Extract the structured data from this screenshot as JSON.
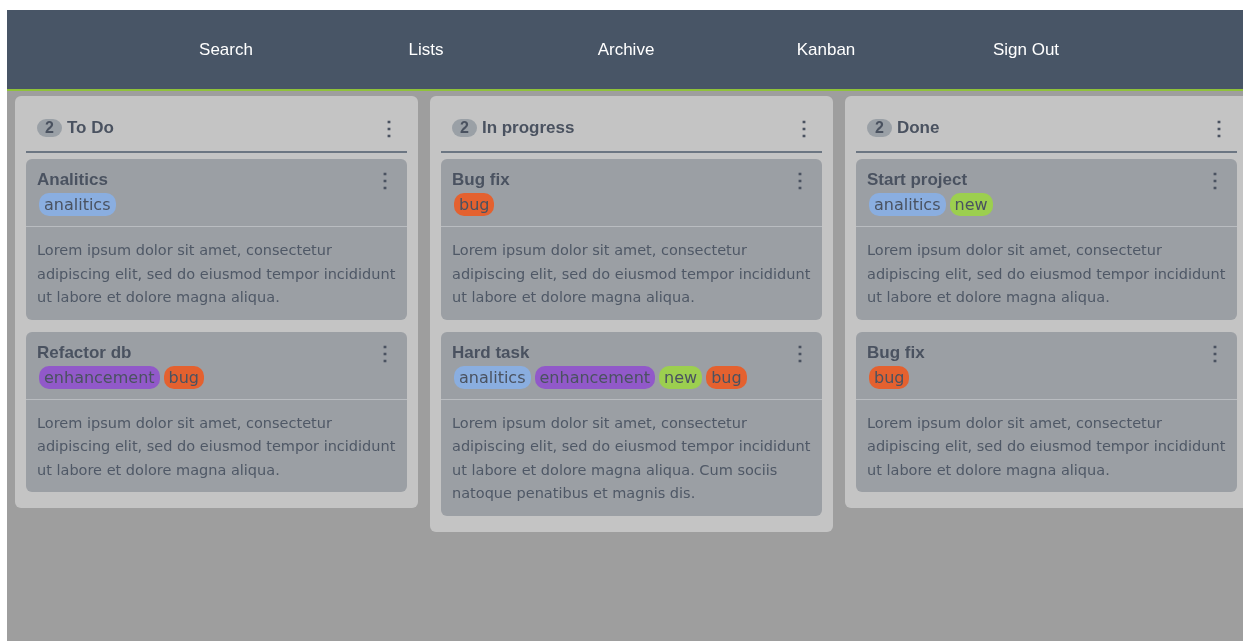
{
  "nav": {
    "items": [
      "Search",
      "Lists",
      "Archive",
      "Kanban",
      "Sign Out"
    ]
  },
  "columns": [
    {
      "count": "2",
      "title": "To Do",
      "menu": "⋮",
      "cards": [
        {
          "title": "Analitics",
          "menu": "⋮",
          "tags": [
            {
              "label": "analitics",
              "color": "#8aaee0"
            }
          ],
          "description": "Lorem ipsum dolor sit amet, consectetur adipiscing elit, sed do eiusmod tempor incididunt ut labore et dolore magna aliqua."
        },
        {
          "title": "Refactor db",
          "menu": "⋮",
          "tags": [
            {
              "label": "enhancement",
              "color": "#9159c9"
            },
            {
              "label": "bug",
              "color": "#e4612f"
            }
          ],
          "description": "Lorem ipsum dolor sit amet, consectetur adipiscing elit, sed do eiusmod tempor incididunt ut labore et dolore magna aliqua."
        }
      ]
    },
    {
      "count": "2",
      "title": "In progress",
      "menu": "⋮",
      "cards": [
        {
          "title": "Bug fix",
          "menu": "⋮",
          "tags": [
            {
              "label": "bug",
              "color": "#e4612f"
            }
          ],
          "description": "Lorem ipsum dolor sit amet, consectetur adipiscing elit, sed do eiusmod tempor incididunt ut labore et dolore magna aliqua."
        },
        {
          "title": "Hard task",
          "menu": "⋮",
          "tags": [
            {
              "label": "analitics",
              "color": "#8aaee0"
            },
            {
              "label": "enhancement",
              "color": "#9159c9"
            },
            {
              "label": "new",
              "color": "#9ccf4f"
            },
            {
              "label": "bug",
              "color": "#e4612f"
            }
          ],
          "description": "Lorem ipsum dolor sit amet, consectetur adipiscing elit, sed do eiusmod tempor incididunt ut labore et dolore magna aliqua. Cum sociis natoque penatibus et magnis dis."
        }
      ]
    },
    {
      "count": "2",
      "title": "Done",
      "menu": "⋮",
      "cards": [
        {
          "title": "Start project",
          "menu": "⋮",
          "tags": [
            {
              "label": "analitics",
              "color": "#8aaee0"
            },
            {
              "label": "new",
              "color": "#9ccf4f"
            }
          ],
          "description": "Lorem ipsum dolor sit amet, consectetur adipiscing elit, sed do eiusmod tempor incididunt ut labore et dolore magna aliqua."
        },
        {
          "title": "Bug fix",
          "menu": "⋮",
          "tags": [
            {
              "label": "bug",
              "color": "#e4612f"
            }
          ],
          "description": "Lorem ipsum dolor sit amet, consectetur adipiscing elit, sed do eiusmod tempor incididunt ut labore et dolore magna aliqua."
        }
      ]
    }
  ]
}
